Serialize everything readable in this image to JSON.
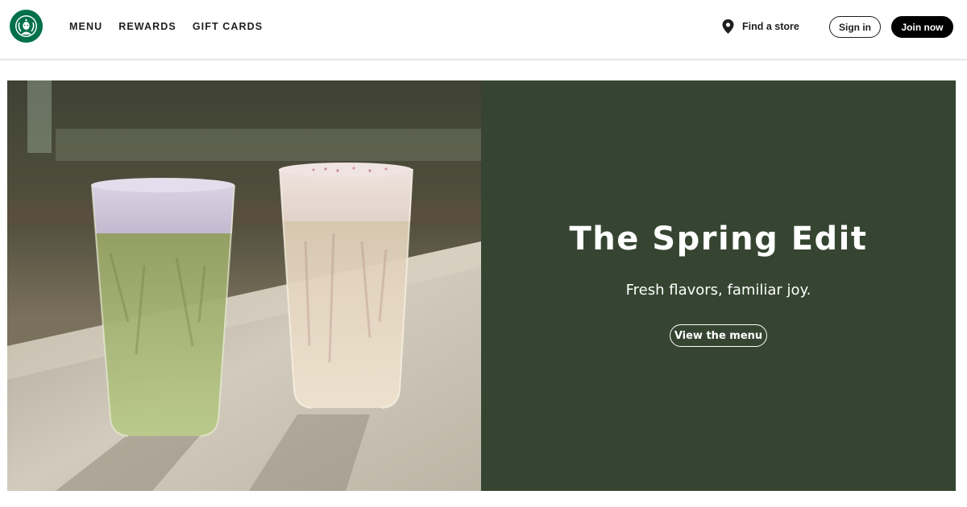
{
  "brand": {
    "logo_icon": "starbucks-siren-logo-icon",
    "accent": "#00704a"
  },
  "nav": {
    "items": [
      {
        "label": "MENU"
      },
      {
        "label": "REWARDS"
      },
      {
        "label": "GIFT CARDS"
      }
    ]
  },
  "header": {
    "find_store": {
      "label": "Find a store",
      "icon": "location-pin-icon"
    },
    "sign_in_label": "Sign in",
    "join_label": "Join now"
  },
  "hero": {
    "image_alt_icon": "two-iced-drinks-photo",
    "panel_color": "#354531",
    "title": "The Spring Edit",
    "subtitle": "Fresh flavors, familiar joy.",
    "cta_label": "View the menu"
  }
}
